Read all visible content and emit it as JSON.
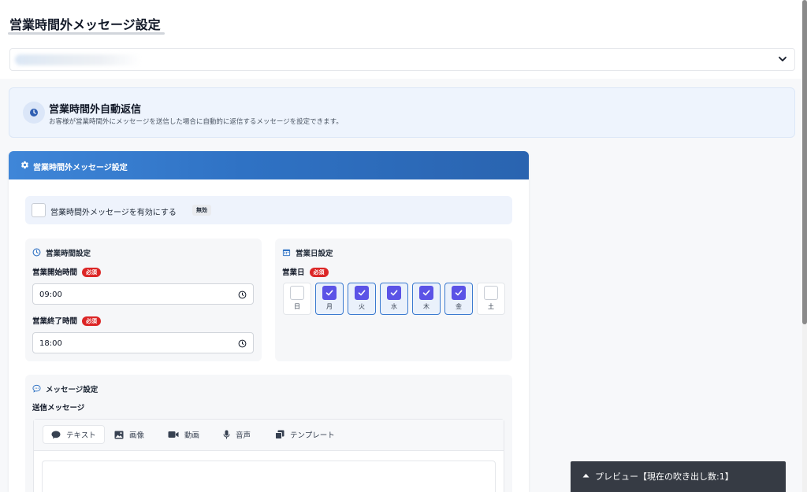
{
  "page": {
    "title": "営業時間外メッセージ設定"
  },
  "info_banner": {
    "title": "営業時間外自動返信",
    "description": "お客様が営業時間外にメッセージを送信した場合に自動的に返信するメッセージを設定できます。",
    "icon": "clock-icon"
  },
  "settings_card": {
    "title": "営業時間外メッセージ設定",
    "icon": "gear-icon",
    "enable": {
      "label": "営業時間外メッセージを有効にする",
      "checked": false,
      "state_badge": "無効"
    },
    "hours": {
      "title": "営業時間設定",
      "required_badge": "必須",
      "start_label": "営業開始時間",
      "start_value": "09:00",
      "end_label": "営業終了時間",
      "end_value": "18:00"
    },
    "days": {
      "title": "営業日設定",
      "field_label": "営業日",
      "required_badge": "必須",
      "items": [
        {
          "label": "日",
          "checked": false
        },
        {
          "label": "月",
          "checked": true
        },
        {
          "label": "火",
          "checked": true
        },
        {
          "label": "水",
          "checked": true
        },
        {
          "label": "木",
          "checked": true
        },
        {
          "label": "金",
          "checked": true
        },
        {
          "label": "土",
          "checked": false
        }
      ]
    },
    "message": {
      "title": "メッセージ設定",
      "field_label": "送信メッセージ",
      "tabs": [
        {
          "label": "テキスト",
          "icon": "chat-bubble-icon",
          "active": true
        },
        {
          "label": "画像",
          "icon": "image-icon",
          "active": false
        },
        {
          "label": "動画",
          "icon": "video-icon",
          "active": false
        },
        {
          "label": "音声",
          "icon": "microphone-icon",
          "active": false
        },
        {
          "label": "テンプレート",
          "icon": "template-icon",
          "active": false
        }
      ]
    }
  },
  "preview": {
    "label": "プレビュー【現在の吹き出し数:1】"
  },
  "colors": {
    "header_blue": "#2f72c4",
    "checkbox_purple": "#5b53e6",
    "required_red": "#dc2626"
  }
}
